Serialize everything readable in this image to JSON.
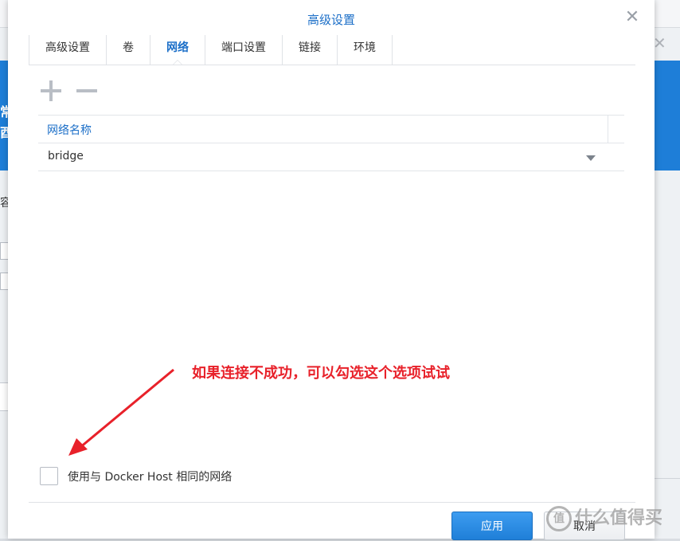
{
  "dialog": {
    "title": "高级设置",
    "close_glyph": "✕"
  },
  "tabs": [
    {
      "label": "高级设置",
      "active": false
    },
    {
      "label": "卷",
      "active": false
    },
    {
      "label": "网络",
      "active": true
    },
    {
      "label": "端口设置",
      "active": false
    },
    {
      "label": "链接",
      "active": false
    },
    {
      "label": "环境",
      "active": false
    }
  ],
  "toolbar": {
    "add_icon": "plus-icon",
    "remove_icon": "minus-icon"
  },
  "network_grid": {
    "column_header": "网络名称",
    "rows": [
      {
        "name": "bridge"
      }
    ]
  },
  "annotation": {
    "text": "如果连接不成功，可以勾选这个选项试试",
    "color": "#e8212a"
  },
  "option": {
    "label": "使用与 Docker Host 相同的网络",
    "checked": false
  },
  "footer": {
    "apply_label": "应用",
    "cancel_label": "取消"
  },
  "watermark": {
    "text": "什么值得买"
  },
  "background": {
    "left_text_1": "常",
    "left_text_2": "酉",
    "left_text_3": "容"
  },
  "colors": {
    "accent": "#1c6fc8",
    "primary_button": "#1f7fd8"
  }
}
